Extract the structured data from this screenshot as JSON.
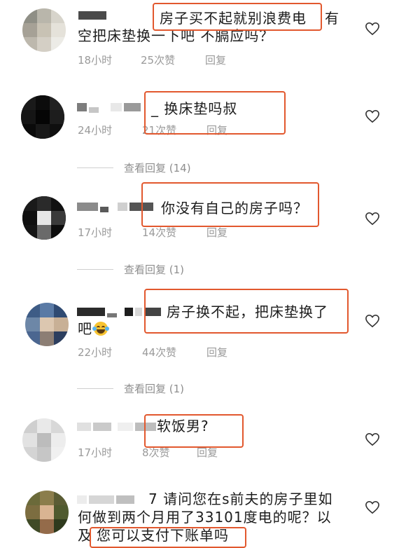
{
  "comments": [
    {
      "text_line1": "房子买不起就别浪费电",
      "text_line1_suffix": "有",
      "text_line2": "空把床垫换一下吧 不膈应吗？",
      "time": "18小时",
      "likes": "25次赞",
      "reply": "回复"
    },
    {
      "text_line1": "_ 换床垫吗叔",
      "time": "24小时",
      "likes": "21次赞",
      "reply": "回复"
    },
    {
      "text_line1": "你没有自己的房子吗？",
      "time": "17小时",
      "likes": "14次赞",
      "reply": "回复"
    },
    {
      "text_line1": "房子换不起，把床垫换了",
      "text_line2": "吧",
      "time": "22小时",
      "likes": "44次赞",
      "reply": "回复"
    },
    {
      "text_line1": "软饭男?",
      "time": "17小时",
      "likes": "8次赞",
      "reply": "回复"
    },
    {
      "text_line1": "7 请问您在s前夫的房子里如",
      "text_line2": "何做到两个月用了33101度电的呢？以",
      "text_line3_a": "及",
      "text_line3_b": "您可以支付下账单吗"
    }
  ],
  "view_replies": [
    "查看回复 (14)",
    "查看回复 (1)",
    "查看回复 (1)"
  ],
  "icons": {
    "like": "heart-outline-icon",
    "emoji": "laughing-tears-emoji-icon"
  },
  "colors": {
    "highlight_box": "#e2582e",
    "meta_text": "#9a9a9a",
    "body_text": "#1c1c1c"
  }
}
